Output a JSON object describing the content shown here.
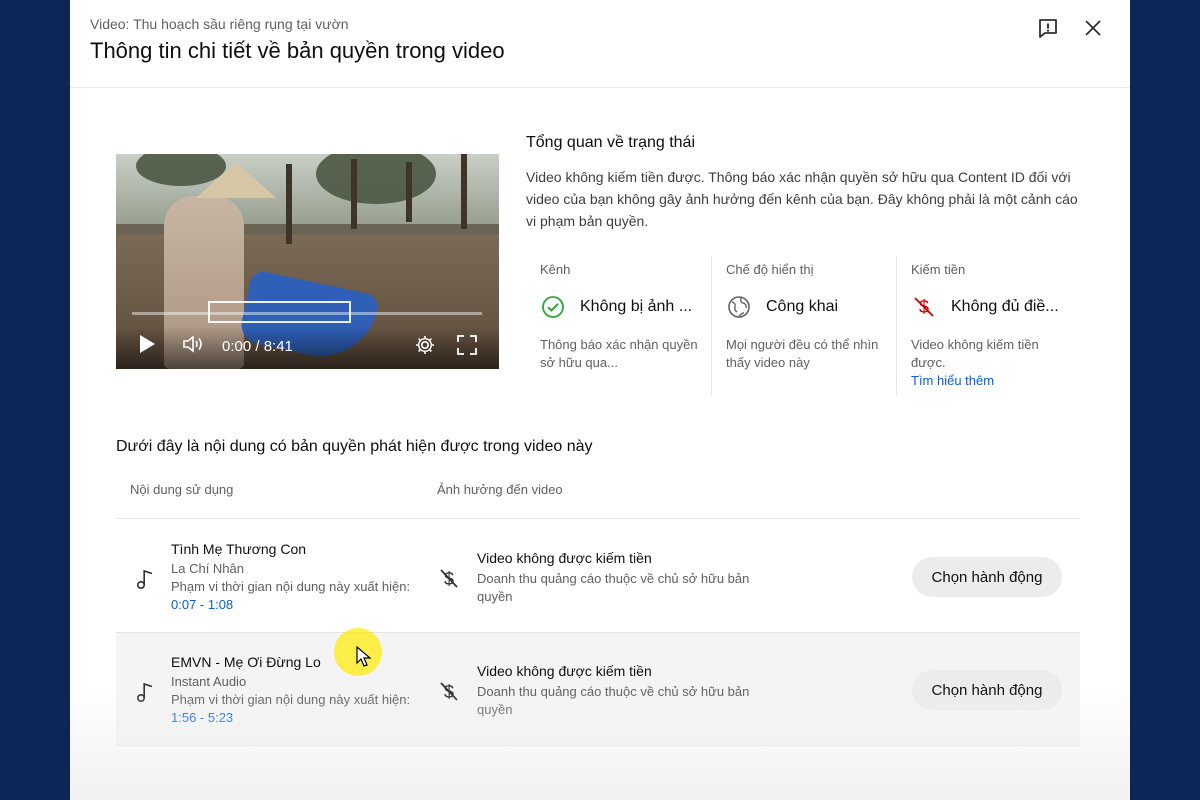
{
  "header": {
    "subtitle": "Video: Thu hoạch sầu riêng rụng tại vườn",
    "title": "Thông tin chi tiết về bản quyền trong video",
    "feedback_icon": "feedback-icon",
    "close_icon": "close-icon"
  },
  "player": {
    "time": "0:00 / 8:41",
    "progress": 0
  },
  "overview": {
    "title": "Tổng quan về trạng thái",
    "description": "Video không kiếm tiền được. Thông báo xác nhận quyền sở hữu qua Content ID đối với video của bạn không gây ảnh hưởng đến kênh của bạn. Đây không phải là một cảnh cáo vi phạm bản quyền.",
    "columns": [
      {
        "label": "Kênh",
        "icon": "check-circle-icon",
        "value": "Không bị ảnh ...",
        "description": "Thông báo xác nhận quyền sở hữu qua..."
      },
      {
        "label": "Chế độ hiển thị",
        "icon": "globe-icon",
        "value": "Công khai",
        "description": "Mọi người đều có thể nhìn thấy video này"
      },
      {
        "label": "Kiếm tiền",
        "icon": "demonetized-icon",
        "value": "Không đủ điề...",
        "description": "Video không kiếm tiền được.",
        "link": "Tìm hiểu thêm"
      }
    ]
  },
  "claims": {
    "section_title": "Dưới đây là nội dung có bản quyền phát hiện được trong video này",
    "headers": [
      "Nội dung sử dụng",
      "Ảnh hưởng đến video"
    ],
    "rows": [
      {
        "title": "Tình Mẹ Thương Con",
        "artist": "La Chí Nhân",
        "range_label": "Phạm vi thời gian nội dung này xuất hiện:",
        "range": "0:07 - 1:08",
        "impact_title": "Video không được kiếm tiền",
        "impact_desc": "Doanh thu quảng cáo thuộc về chủ sở hữu bản quyền",
        "action": "Chọn hành động"
      },
      {
        "title": "EMVN - Mẹ Ơi Đừng Lo",
        "artist": "Instant Audio",
        "range_label": "Phạm vi thời gian nội dung này xuất hiện:",
        "range": "1:56 - 5:23",
        "impact_title": "Video không được kiếm tiền",
        "impact_desc": "Doanh thu quảng cáo thuộc về chủ sở hữu bản quyền",
        "action": "Chọn hành động"
      }
    ]
  },
  "colors": {
    "accent_link": "#065fd4",
    "check_green": "#2ba640",
    "demonetized_red": "#cc0000",
    "background": "#0d2557"
  }
}
